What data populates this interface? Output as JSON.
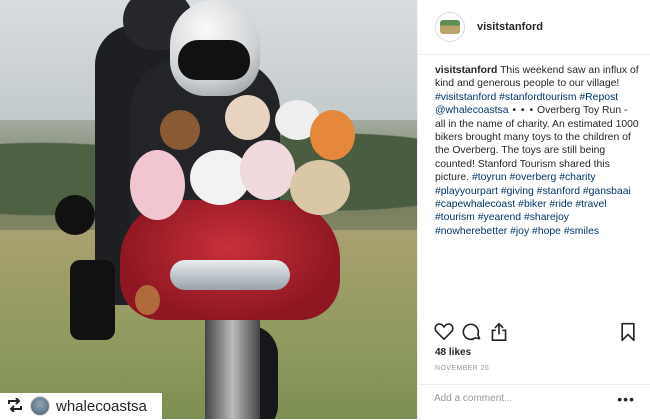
{
  "header": {
    "username": "visitstanford"
  },
  "caption": {
    "username": "visitstanford",
    "segments": [
      {
        "text": "This weekend saw an influx of kind and generous people to our village! ",
        "tag": false
      },
      {
        "text": "#visitstanford #stanfordtourism #Repost @whalecoastsa",
        "tag": true
      },
      {
        "text": " • • •",
        "tag": false,
        "dots": true
      },
      {
        "text": " Overberg Toy Run - all in the name of charity. An estimated 1000 bikers brought many toys to the children of the Overberg. The toys are still being counted! Stanford Tourism shared this picture. ",
        "tag": false
      },
      {
        "text": "#toyrun #overberg #charity #playyourpart #giving #stanford #gansbaai #capewhalecoast #biker #ride #travel #tourism #yearend #sharejoy #nowherebetter #joy #hope #smiles",
        "tag": true
      }
    ]
  },
  "actions": {
    "like_icon": "heart-icon",
    "comment_icon": "comment-icon",
    "share_icon": "share-icon",
    "save_icon": "bookmark-icon"
  },
  "likes": "48 likes",
  "date": "NOVEMBER 26",
  "comment": {
    "placeholder": "Add a comment..."
  },
  "more_label": "•••",
  "repost_badge": {
    "icon": "repost-icon",
    "username": "whalecoastsa"
  }
}
